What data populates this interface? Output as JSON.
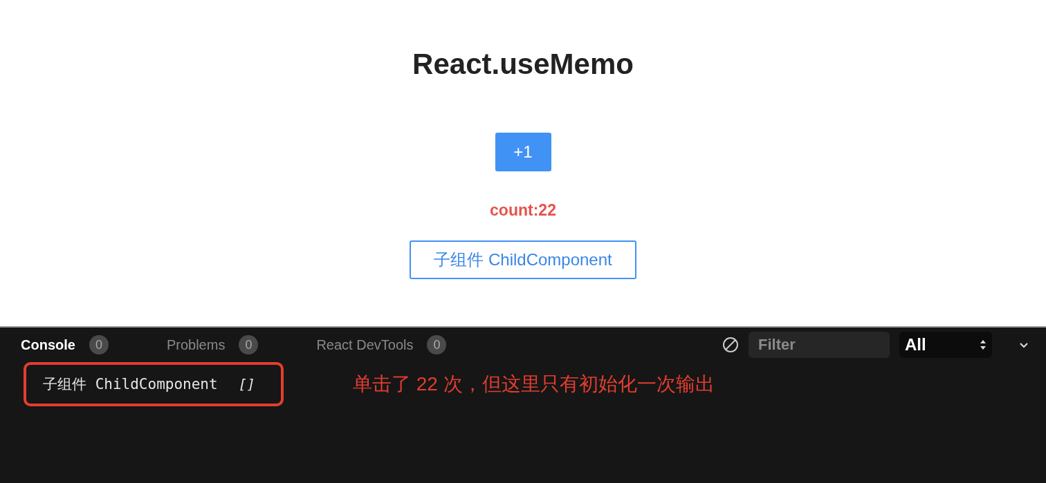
{
  "page": {
    "title": "React.useMemo",
    "increment_button": "+1",
    "count": "count:22",
    "child_button": "子组件 ChildComponent"
  },
  "console": {
    "tabs": [
      {
        "label": "Console",
        "count": "0",
        "selected": true
      },
      {
        "label": "Problems",
        "count": "0",
        "selected": false
      },
      {
        "label": "React DevTools",
        "count": "0",
        "selected": false
      }
    ],
    "filter": {
      "placeholder": "Filter"
    },
    "level_select": "All",
    "log": [
      {
        "message": "子组件 ChildComponent",
        "value": "[]",
        "highlighted": true
      }
    ],
    "annotation": "单击了 22 次，但这里只有初始化一次输出"
  }
}
